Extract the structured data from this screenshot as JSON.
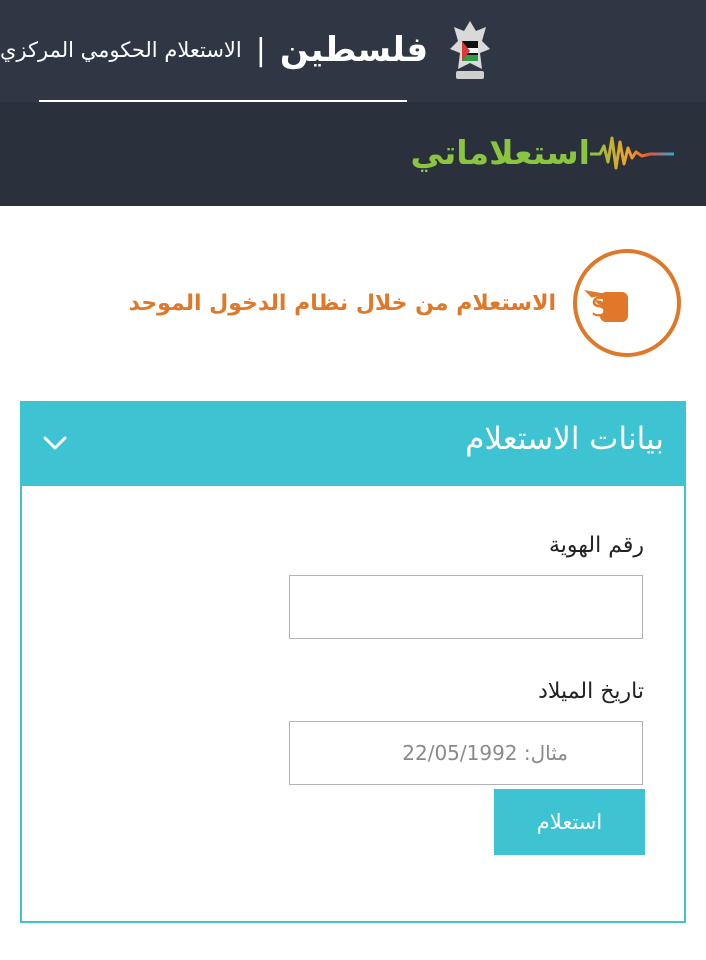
{
  "header": {
    "brand": "فلسطين",
    "separator": "|",
    "subtitle": "الاستعلام الحكومي المركزي",
    "app_name": "استعلاماتي"
  },
  "sso": {
    "logo_text": "SSO",
    "text": "الاستعلام من خلال نظام الدخول الموحد"
  },
  "form": {
    "panel_title": "بيانات الاستعلام",
    "id_label": "رقم الهوية",
    "id_value": "",
    "dob_label": "تاريخ الميلاد",
    "dob_placeholder": "مثال: 22/05/1992",
    "submit_label": "استعلام"
  },
  "colors": {
    "header_bg": "#2f3744",
    "accent": "#3ec3d3",
    "sso_orange": "#e0782a",
    "app_green": "#8bc53f"
  }
}
